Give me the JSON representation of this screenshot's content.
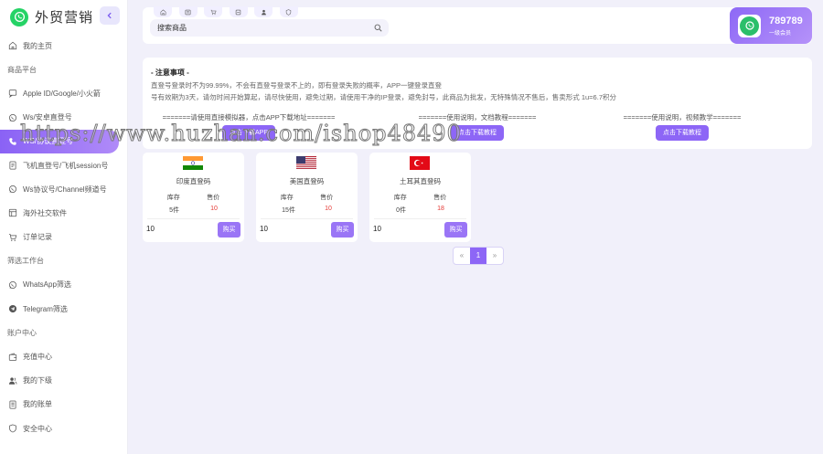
{
  "app": {
    "title": "外贸营销"
  },
  "sidebar": {
    "items": [
      {
        "label": "我的主页",
        "icon": "home-icon",
        "type": "link"
      },
      {
        "label": "商品平台",
        "type": "section"
      },
      {
        "label": "Apple ID/Google/小火箭",
        "icon": "message-icon",
        "type": "link"
      },
      {
        "label": "Ws/安卓直登号",
        "icon": "whatsapp-icon",
        "type": "link"
      },
      {
        "label": "WS/协议直登号",
        "icon": "phone-icon",
        "type": "link",
        "active": true
      },
      {
        "label": "飞机直登号/飞机session号",
        "icon": "document-icon",
        "type": "link"
      },
      {
        "label": "Ws协议号/Channel频道号",
        "icon": "whatsapp-icon",
        "type": "link"
      },
      {
        "label": "海外社交软件",
        "icon": "grid-icon",
        "type": "link"
      },
      {
        "label": "订单记录",
        "icon": "cart-icon",
        "type": "link"
      },
      {
        "label": "筛选工作台",
        "type": "section"
      },
      {
        "label": "WhatsApp筛选",
        "icon": "whatsapp-icon",
        "type": "link"
      },
      {
        "label": "Telegram筛选",
        "icon": "telegram-icon",
        "type": "link"
      },
      {
        "label": "账户中心",
        "type": "section"
      },
      {
        "label": "充值中心",
        "icon": "wallet-icon",
        "type": "link"
      },
      {
        "label": "我的下级",
        "icon": "users-icon",
        "type": "link"
      },
      {
        "label": "我的账单",
        "icon": "bill-icon",
        "type": "link"
      },
      {
        "label": "安全中心",
        "icon": "shield-icon",
        "type": "link"
      }
    ]
  },
  "header": {
    "shortcuts": [
      "home-icon",
      "product-icon",
      "cart-icon",
      "order-icon",
      "user-icon",
      "shield-icon"
    ],
    "search": {
      "placeholder": "搜索商品"
    }
  },
  "user": {
    "name": "789789",
    "level": "一级会员"
  },
  "notice": {
    "title": "- 注意事项 -",
    "lines": [
      "直登号登录时不为99.99%，不会有直登号登录不上的，即有登录失败的概率，APP一键登录直登",
      "号有效期为3天，请勿时间开始算起，请尽快使用，避免过期，请使用干净的IP登录，避免封号，此商品为批发，无特殊情况不售后，售卖形式 1u=6.7积分"
    ],
    "downloads": [
      {
        "caption": "=======请使用直接模拟器，点击APP下载地址=======",
        "button": "点击下载APP"
      },
      {
        "caption": "=======使用说明，文档教程=======",
        "button": "点击下载教程"
      },
      {
        "caption": "=======使用说明，视频教学=======",
        "button": "点击下载教程"
      }
    ]
  },
  "products": [
    {
      "name": "印度直登码",
      "flag": "india-flag",
      "stock_label": "库存",
      "price_label": "售价",
      "stock": "5件",
      "price": "10",
      "quantity": "10",
      "buy_label": "购买"
    },
    {
      "name": "美国直登码",
      "flag": "usa-flag",
      "stock_label": "库存",
      "price_label": "售价",
      "stock": "15件",
      "price": "10",
      "quantity": "10",
      "buy_label": "购买"
    },
    {
      "name": "土耳其直登码",
      "flag": "turkey-flag",
      "stock_label": "库存",
      "price_label": "售价",
      "stock": "0件",
      "price": "18",
      "quantity": "10",
      "buy_label": "购买"
    }
  ],
  "pagination": {
    "prev": "«",
    "current": "1",
    "next": "»"
  },
  "watermark": "https://www.huzhan.com/ishop48490",
  "colors": {
    "accent": "#8d66f6",
    "price": "#e53935",
    "brand": "#25d366"
  }
}
